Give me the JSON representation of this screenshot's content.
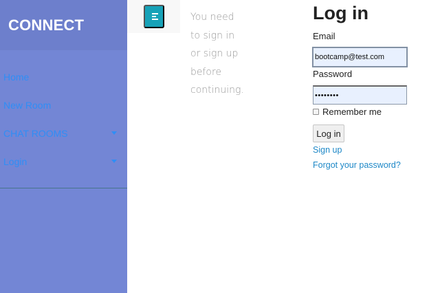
{
  "sidebar": {
    "brand": "CONNECT",
    "items": [
      {
        "label": "Home",
        "has_caret": false
      },
      {
        "label": "New Room",
        "has_caret": false
      },
      {
        "label": "CHAT ROOMS",
        "has_caret": true
      },
      {
        "label": "Login",
        "has_caret": true
      }
    ]
  },
  "toggle": {
    "icon": "align-left-icon"
  },
  "message": {
    "lines": [
      "You need",
      "to sign in",
      "or sign up",
      "before",
      "continuing."
    ]
  },
  "login": {
    "title": "Log in",
    "email_label": "Email",
    "email_value": "bootcamp@test.com",
    "password_label": "Password",
    "password_value": "••••••••",
    "remember_label": "Remember me",
    "remember_checked": false,
    "submit_label": "Log in",
    "signup_link": "Sign up",
    "forgot_link": "Forgot your password?"
  },
  "colors": {
    "sidebar_bg": "#7386d5",
    "sidebar_header_bg": "#6d7fcc",
    "toggle_btn": "#17a2b8",
    "nav_link": "#2f8ef5",
    "link": "#1e88c7"
  }
}
